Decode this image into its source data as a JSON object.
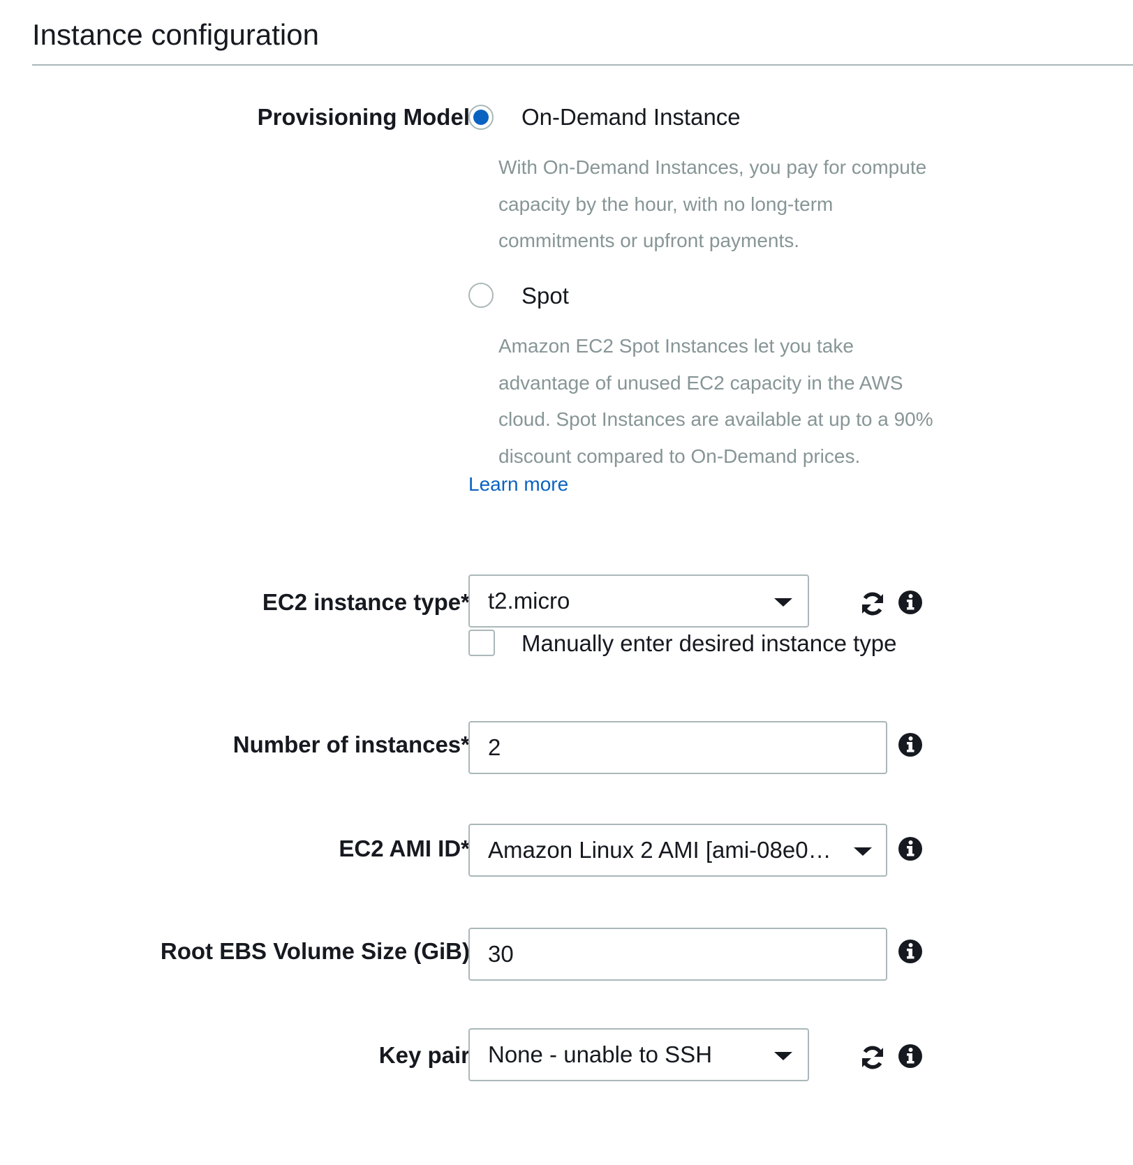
{
  "section": {
    "title": "Instance configuration"
  },
  "provisioning": {
    "label": "Provisioning Model",
    "options": [
      {
        "label": "On-Demand Instance",
        "checked": true,
        "description": "With On-Demand Instances, you pay for compute capacity by the hour, with no long-term commitments or upfront payments."
      },
      {
        "label": "Spot",
        "checked": false,
        "description": "Amazon EC2 Spot Instances let you take advantage of unused EC2 capacity in the AWS cloud. Spot Instances are available at up to a 90% discount compared to On-Demand prices."
      }
    ],
    "learn_more": "Learn more"
  },
  "instance_type": {
    "label": "EC2 instance type*",
    "value": "t2.micro",
    "manual_checkbox_label": "Manually enter desired instance type",
    "manual_checked": false
  },
  "num_instances": {
    "label": "Number of instances*",
    "value": "2"
  },
  "ami": {
    "label": "EC2 AMI ID*",
    "value": "Amazon Linux 2 AMI [ami-08e0…"
  },
  "root_volume": {
    "label": "Root EBS Volume Size (GiB)",
    "value": "30"
  },
  "key_pair": {
    "label": "Key pair",
    "value": "None - unable to SSH"
  },
  "icons": {
    "refresh": "refresh-icon",
    "info": "info-icon",
    "dropdown": "caret-down-icon"
  },
  "colors": {
    "accent": "#0b63c1",
    "link": "#0b62c1",
    "border": "#aab7b8",
    "muted_text": "#879596",
    "text": "#16191f"
  }
}
